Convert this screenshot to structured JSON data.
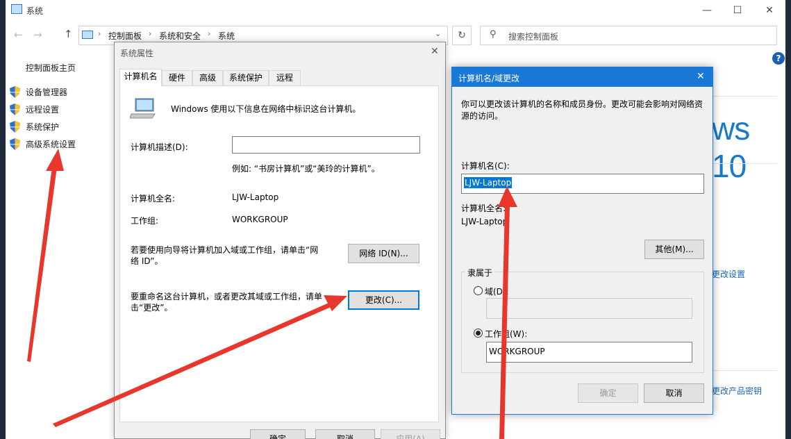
{
  "window": {
    "title": "系统",
    "minimize": "—",
    "maximize": "☐",
    "close": "✕"
  },
  "nav": {
    "back": "←",
    "forward": "→",
    "up": "↑",
    "breadcrumbs": [
      "控制面板",
      "系统和安全",
      "系统"
    ],
    "separator": "›",
    "dropdown": "⌄",
    "refresh": "↻",
    "search_placeholder": "搜索控制面板",
    "search_glyph": "⚲"
  },
  "sidebar": {
    "home": "控制面板主页",
    "items": [
      {
        "label": "设备管理器"
      },
      {
        "label": "远程设置"
      },
      {
        "label": "系统保护"
      },
      {
        "label": "高级系统设置"
      }
    ]
  },
  "background_main": {
    "help": "?",
    "windows_text": "ws 10",
    "change_settings": "更改设置",
    "change_product_key": "更改产品密钥"
  },
  "system_properties": {
    "title": "系统属性",
    "close": "✕",
    "tabs": [
      "计算机名",
      "硬件",
      "高级",
      "系统保护",
      "远程"
    ],
    "intro": "Windows 使用以下信息在网络中标识这台计算机。",
    "description_label": "计算机描述(D):",
    "description_value": "",
    "description_example": "例如: “书房计算机”或“美玲的计算机”。",
    "full_name_label": "计算机全名:",
    "full_name_value": "LJW-Laptop",
    "workgroup_label": "工作组:",
    "workgroup_value": "WORKGROUP",
    "network_id_text": "若要使用向导将计算机加入域或工作组，请单击“网络 ID”。",
    "network_id_button": "网络 ID(N)...",
    "rename_text": "要重命名这台计算机，或者更改其域或工作组，请单击“更改”。",
    "change_button": "更改(C)...",
    "ok": "确定",
    "cancel": "取消",
    "apply": "应用(A)"
  },
  "computer_name_dialog": {
    "title": "计算机名/域更改",
    "close": "✕",
    "intro": "你可以更改该计算机的名称和成员身份。更改可能会影响对网络资源的访问。",
    "name_label": "计算机名(C):",
    "name_value": "LJW-Laptop",
    "full_name_label": "计算机全名:",
    "full_name_value": "LJW-Laptop",
    "other_button": "其他(M)...",
    "member_of": "隶属于",
    "domain_label": "域(D):",
    "domain_value": "",
    "workgroup_label": "工作组(W):",
    "workgroup_value": "WORKGROUP",
    "ok": "确定",
    "cancel": "取消"
  },
  "colors": {
    "accent": "#0078d7",
    "dialog_titlebar": "#1879d6",
    "annotation_arrow": "#e8362c",
    "link": "#1a66b8"
  }
}
